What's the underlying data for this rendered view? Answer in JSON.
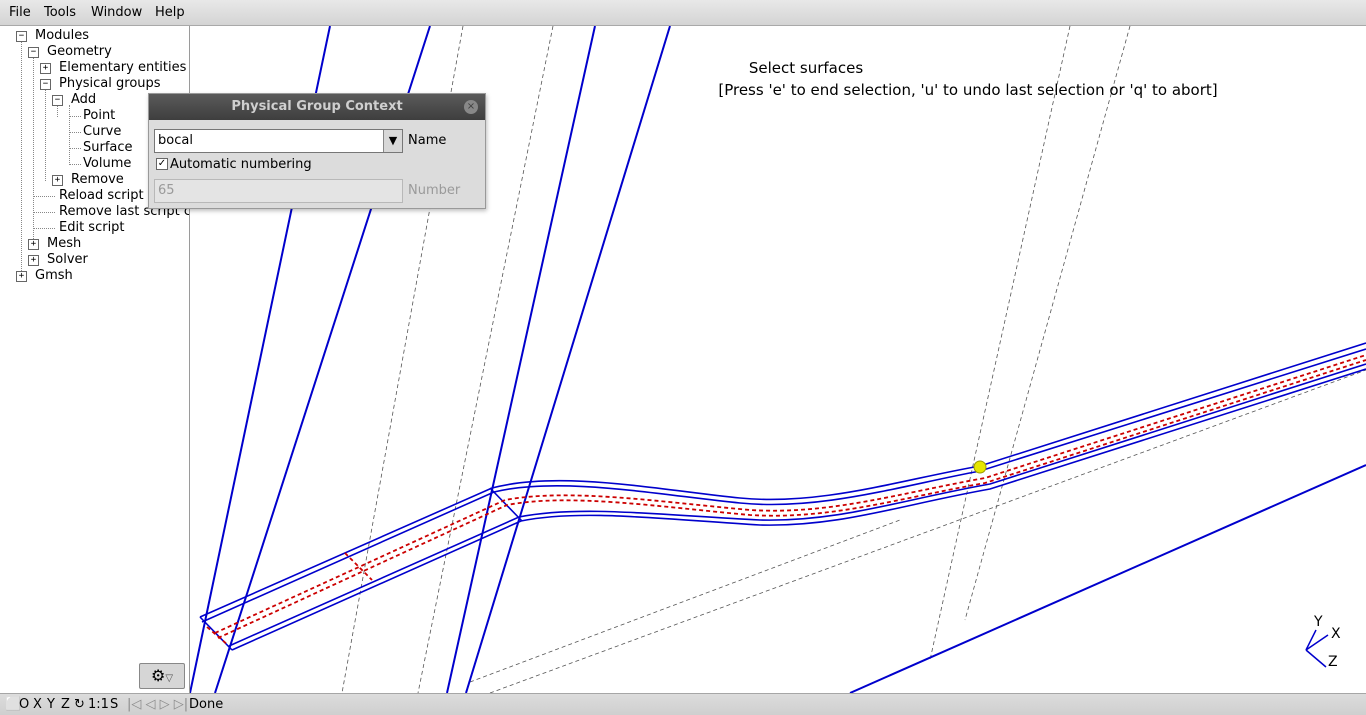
{
  "menu": {
    "file": "File",
    "tools": "Tools",
    "window": "Window",
    "help": "Help"
  },
  "tree": {
    "modules": "Modules",
    "geometry": "Geometry",
    "elementary_entities": "Elementary entities",
    "physical_groups": "Physical groups",
    "add": "Add",
    "point": "Point",
    "curve": "Curve",
    "surface": "Surface",
    "volume": "Volume",
    "remove": "Remove",
    "reload_script": "Reload script",
    "remove_last_script": "Remove last script c",
    "edit_script": "Edit script",
    "mesh": "Mesh",
    "solver": "Solver",
    "gmsh": "Gmsh"
  },
  "viewport": {
    "banner_title": "Select surfaces",
    "banner_hint": "[Press 'e' to end selection, 'u' to undo last selection or 'q' to abort]",
    "axes": {
      "x": "X",
      "y": "Y",
      "z": "Z"
    }
  },
  "dialog": {
    "title": "Physical Group Context",
    "name_value": "bocal",
    "name_label": "Name",
    "auto_numbering_label": "Automatic numbering",
    "auto_numbering_checked": true,
    "number_value": "65",
    "number_label": "Number"
  },
  "statusbar": {
    "o": "O",
    "x": "X",
    "y": "Y",
    "z": "Z",
    "rotate_icon": "rotate-icon",
    "scale": "1:1",
    "s": "S",
    "status": "Done"
  },
  "colors": {
    "geometry_lines": "#0000cc",
    "curve_dashed": "#cc0000",
    "selection_point": "#e6e600"
  }
}
